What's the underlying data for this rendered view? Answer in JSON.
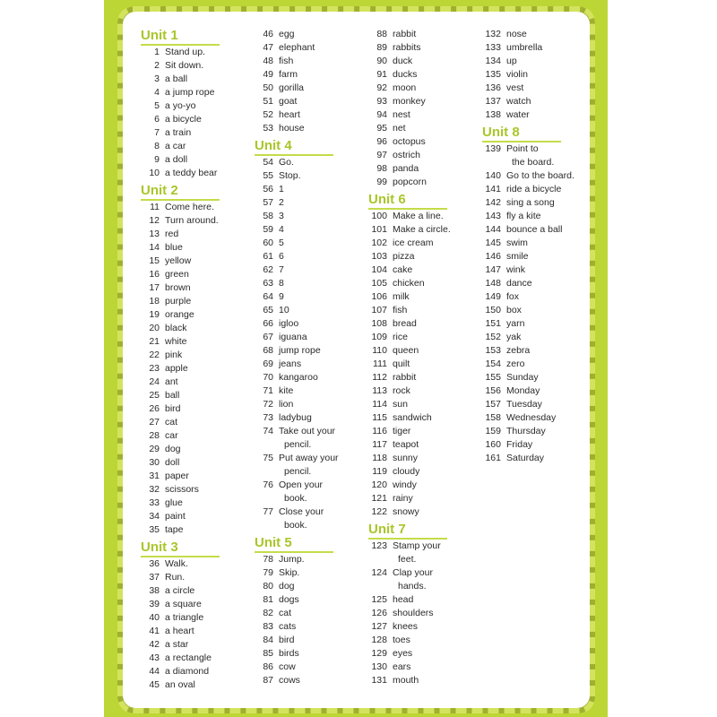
{
  "colors": {
    "page": "#bcd635",
    "unit_heading": "#a9c62a",
    "text": "#2a2a2a"
  },
  "columns": [
    [
      {
        "unit": "Unit 1",
        "items": [
          [
            "1",
            "Stand up."
          ],
          [
            "2",
            "Sit down."
          ],
          [
            "3",
            "a ball"
          ],
          [
            "4",
            "a jump rope"
          ],
          [
            "5",
            "a yo-yo"
          ],
          [
            "6",
            "a bicycle"
          ],
          [
            "7",
            "a train"
          ],
          [
            "8",
            "a car"
          ],
          [
            "9",
            "a doll"
          ],
          [
            "10",
            "a teddy bear"
          ]
        ]
      },
      {
        "unit": "Unit 2",
        "items": [
          [
            "11",
            "Come here."
          ],
          [
            "12",
            "Turn around."
          ],
          [
            "13",
            "red"
          ],
          [
            "14",
            "blue"
          ],
          [
            "15",
            "yellow"
          ],
          [
            "16",
            "green"
          ],
          [
            "17",
            "brown"
          ],
          [
            "18",
            "purple"
          ],
          [
            "19",
            "orange"
          ],
          [
            "20",
            "black"
          ],
          [
            "21",
            "white"
          ],
          [
            "22",
            "pink"
          ],
          [
            "23",
            "apple"
          ],
          [
            "24",
            "ant"
          ],
          [
            "25",
            "ball"
          ],
          [
            "26",
            "bird"
          ],
          [
            "27",
            "cat"
          ],
          [
            "28",
            "car"
          ],
          [
            "29",
            "dog"
          ],
          [
            "30",
            "doll"
          ],
          [
            "31",
            "paper"
          ],
          [
            "32",
            "scissors"
          ],
          [
            "33",
            "glue"
          ],
          [
            "34",
            "paint"
          ],
          [
            "35",
            "tape"
          ]
        ]
      },
      {
        "unit": "Unit 3",
        "items": [
          [
            "36",
            "Walk."
          ],
          [
            "37",
            "Run."
          ],
          [
            "38",
            "a circle"
          ],
          [
            "39",
            "a square"
          ],
          [
            "40",
            "a triangle"
          ],
          [
            "41",
            "a heart"
          ],
          [
            "42",
            "a star"
          ],
          [
            "43",
            "a rectangle"
          ],
          [
            "44",
            "a diamond"
          ],
          [
            "45",
            "an oval"
          ]
        ]
      }
    ],
    [
      {
        "unit": "",
        "items": [
          [
            "46",
            "egg"
          ],
          [
            "47",
            "elephant"
          ],
          [
            "48",
            "fish"
          ],
          [
            "49",
            "farm"
          ],
          [
            "50",
            "gorilla"
          ],
          [
            "51",
            "goat"
          ],
          [
            "52",
            "heart"
          ],
          [
            "53",
            "house"
          ]
        ]
      },
      {
        "unit": "Unit 4",
        "items": [
          [
            "54",
            "Go."
          ],
          [
            "55",
            "Stop."
          ],
          [
            "56",
            "1"
          ],
          [
            "57",
            "2"
          ],
          [
            "58",
            "3"
          ],
          [
            "59",
            "4"
          ],
          [
            "60",
            "5"
          ],
          [
            "61",
            "6"
          ],
          [
            "62",
            "7"
          ],
          [
            "63",
            "8"
          ],
          [
            "64",
            "9"
          ],
          [
            "65",
            "10"
          ],
          [
            "66",
            "igloo"
          ],
          [
            "67",
            "iguana"
          ],
          [
            "68",
            "jump rope"
          ],
          [
            "69",
            "jeans"
          ],
          [
            "70",
            "kangaroo"
          ],
          [
            "71",
            "kite"
          ],
          [
            "72",
            "lion"
          ],
          [
            "73",
            "ladybug"
          ],
          [
            "74",
            "Take out your",
            "pencil."
          ],
          [
            "75",
            "Put away your",
            "pencil."
          ],
          [
            "76",
            "Open your",
            "book."
          ],
          [
            "77",
            "Close your",
            "book."
          ]
        ]
      },
      {
        "unit": "Unit 5",
        "items": [
          [
            "78",
            "Jump."
          ],
          [
            "79",
            "Skip."
          ],
          [
            "80",
            "dog"
          ],
          [
            "81",
            "dogs"
          ],
          [
            "82",
            "cat"
          ],
          [
            "83",
            "cats"
          ],
          [
            "84",
            "bird"
          ],
          [
            "85",
            "birds"
          ],
          [
            "86",
            "cow"
          ],
          [
            "87",
            "cows"
          ]
        ]
      }
    ],
    [
      {
        "unit": "",
        "items": [
          [
            "88",
            "rabbit"
          ],
          [
            "89",
            "rabbits"
          ],
          [
            "90",
            "duck"
          ],
          [
            "91",
            "ducks"
          ],
          [
            "92",
            "moon"
          ],
          [
            "93",
            "monkey"
          ],
          [
            "94",
            "nest"
          ],
          [
            "95",
            "net"
          ],
          [
            "96",
            "octopus"
          ],
          [
            "97",
            "ostrich"
          ],
          [
            "98",
            "panda"
          ],
          [
            "99",
            "popcorn"
          ]
        ]
      },
      {
        "unit": "Unit 6",
        "items": [
          [
            "100",
            "Make a line."
          ],
          [
            "101",
            "Make a circle."
          ],
          [
            "102",
            "ice cream"
          ],
          [
            "103",
            "pizza"
          ],
          [
            "104",
            "cake"
          ],
          [
            "105",
            "chicken"
          ],
          [
            "106",
            "milk"
          ],
          [
            "107",
            "fish"
          ],
          [
            "108",
            "bread"
          ],
          [
            "109",
            "rice"
          ],
          [
            "110",
            "queen"
          ],
          [
            "111",
            "quilt"
          ],
          [
            "112",
            "rabbit"
          ],
          [
            "113",
            "rock"
          ],
          [
            "114",
            "sun"
          ],
          [
            "115",
            "sandwich"
          ],
          [
            "116",
            "tiger"
          ],
          [
            "117",
            "teapot"
          ],
          [
            "118",
            "sunny"
          ],
          [
            "119",
            "cloudy"
          ],
          [
            "120",
            "windy"
          ],
          [
            "121",
            "rainy"
          ],
          [
            "122",
            "snowy"
          ]
        ]
      },
      {
        "unit": "Unit 7",
        "items": [
          [
            "123",
            "Stamp your",
            "feet."
          ],
          [
            "124",
            "Clap your",
            "hands."
          ],
          [
            "125",
            "head"
          ],
          [
            "126",
            "shoulders"
          ],
          [
            "127",
            "knees"
          ],
          [
            "128",
            "toes"
          ],
          [
            "129",
            "eyes"
          ],
          [
            "130",
            "ears"
          ],
          [
            "131",
            "mouth"
          ]
        ]
      }
    ],
    [
      {
        "unit": "",
        "items": [
          [
            "132",
            "nose"
          ],
          [
            "133",
            "umbrella"
          ],
          [
            "134",
            "up"
          ],
          [
            "135",
            "violin"
          ],
          [
            "136",
            "vest"
          ],
          [
            "137",
            "watch"
          ],
          [
            "138",
            "water"
          ]
        ]
      },
      {
        "unit": "Unit 8",
        "items": [
          [
            "139",
            "Point to",
            "the board."
          ],
          [
            "140",
            "Go to the board."
          ],
          [
            "141",
            "ride a bicycle"
          ],
          [
            "142",
            "sing a song"
          ],
          [
            "143",
            "fly a kite"
          ],
          [
            "144",
            "bounce a ball"
          ],
          [
            "145",
            "swim"
          ],
          [
            "146",
            "smile"
          ],
          [
            "147",
            "wink"
          ],
          [
            "148",
            "dance"
          ],
          [
            "149",
            "fox"
          ],
          [
            "150",
            "box"
          ],
          [
            "151",
            "yarn"
          ],
          [
            "152",
            "yak"
          ],
          [
            "153",
            "zebra"
          ],
          [
            "154",
            "zero"
          ],
          [
            "155",
            "Sunday"
          ],
          [
            "156",
            "Monday"
          ],
          [
            "157",
            "Tuesday"
          ],
          [
            "158",
            "Wednesday"
          ],
          [
            "159",
            "Thursday"
          ],
          [
            "160",
            "Friday"
          ],
          [
            "161",
            "Saturday"
          ]
        ]
      }
    ]
  ]
}
